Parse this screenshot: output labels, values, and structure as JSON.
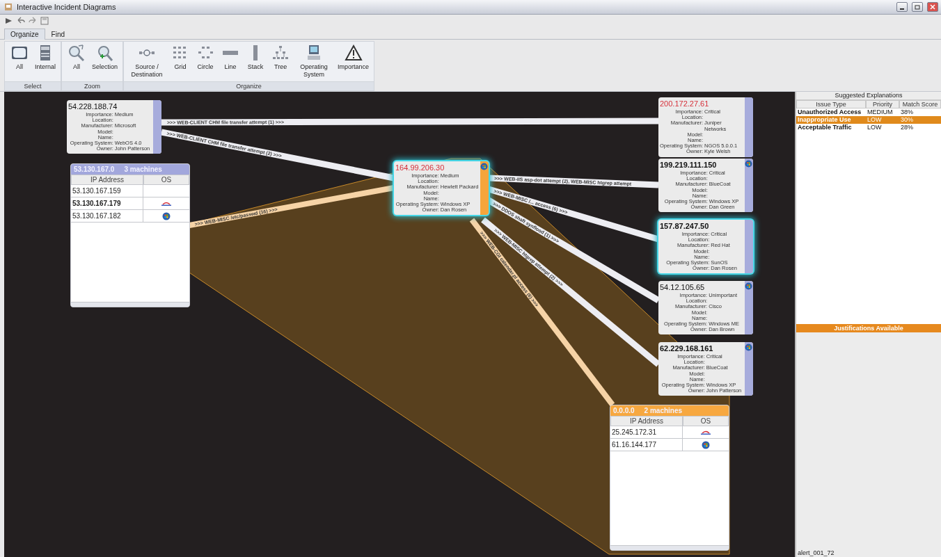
{
  "window": {
    "title": "Interactive Incident Diagrams"
  },
  "tabs": [
    {
      "label": "Organize",
      "selected": true
    },
    {
      "label": "Find",
      "selected": false
    }
  ],
  "ribbon": {
    "groups": [
      {
        "label": "Select",
        "buttons": [
          {
            "kind": "screen",
            "label": "All"
          },
          {
            "kind": "server",
            "label": "Internal"
          }
        ]
      },
      {
        "label": "Zoom",
        "buttons": [
          {
            "kind": "zoom-all",
            "label": "All"
          },
          {
            "kind": "zoom-selection",
            "label": "Selection"
          }
        ]
      },
      {
        "label": "Organize",
        "buttons": [
          {
            "kind": "source-destination",
            "label": "Source / Destination"
          },
          {
            "kind": "grid",
            "label": "Grid"
          },
          {
            "kind": "circle",
            "label": "Circle"
          },
          {
            "kind": "line",
            "label": "Line"
          },
          {
            "kind": "stack",
            "label": "Stack"
          },
          {
            "kind": "tree",
            "label": "Tree"
          },
          {
            "kind": "computer",
            "label": "Operating System"
          },
          {
            "kind": "warning",
            "label": "Importance"
          }
        ]
      }
    ]
  },
  "diagram": {
    "hull": true,
    "connections": [
      {
        "kind": "host-link",
        "label": ">>> WEB-CLIENT CHM file transfer attempt (1) >>>"
      },
      {
        "kind": "host-link",
        "label": ">>> WEB-CLIENT CHM file transfer attempt (2) >>>"
      },
      {
        "kind": "group-link",
        "label": ">>> WEB-MISC /etc/passwd (16) >>>"
      },
      {
        "kind": "host-link",
        "label": ">>> WEB-IIS asp-dot attempt (2), WEB-MISC htgrep attempt"
      },
      {
        "kind": "host-link",
        "label": ">>> WEB-MISC /... access (6) >>>"
      },
      {
        "kind": "host-link",
        "label": ">>> DDOS shaft synflood (1) >>>"
      },
      {
        "kind": "host-link",
        "label": ">>> WEB-MISC htgrep attempt (2) >>>"
      },
      {
        "kind": "group-link",
        "label": ">>> WEB-CGI calendar.pl access (6) >>>"
      }
    ],
    "hosts": [
      {
        "ip": "54.228.188.74",
        "alert": false,
        "highlighted": false,
        "kind": "host",
        "details": [
          {
            "label": "Importance:",
            "value": "Medium"
          },
          {
            "label": "Location:"
          },
          {
            "label": "Manufacturer:",
            "value": "Microsoft"
          },
          {
            "label": "Model:"
          },
          {
            "label": "Name:"
          },
          {
            "label": "Operating System:",
            "value": "WebOS 4.0"
          },
          {
            "label": "Owner:",
            "value": "John Patterson"
          }
        ]
      },
      {
        "ip": "200.172.27.61",
        "alert": true,
        "highlighted": false,
        "kind": "host",
        "details": [
          {
            "label": "Importance:",
            "value": "Critical"
          },
          {
            "label": "Location:"
          },
          {
            "label": "Manufacturer:",
            "value": "Juniper Networks"
          },
          {
            "label": "Model:"
          },
          {
            "label": "Name:"
          },
          {
            "label": "Operating System:",
            "value": "NGOS 5.0.0.1"
          },
          {
            "label": "Owner:",
            "value": "Kyle Welsh"
          }
        ]
      },
      {
        "ip": "164.99.206.30",
        "alert": true,
        "highlighted": true,
        "kind": "source",
        "details": [
          {
            "label": "Importance:",
            "value": "Medium"
          },
          {
            "label": "Location:"
          },
          {
            "label": "Manufacturer:",
            "value": "Hewlett Packard"
          },
          {
            "label": "Model:"
          },
          {
            "label": "Name:"
          },
          {
            "label": "Operating System:",
            "value": "Windows XP"
          },
          {
            "label": "Owner:",
            "value": "Dan Rosen"
          }
        ]
      },
      {
        "ip": "199.219.111.150",
        "alert": false,
        "highlighted": false,
        "kind": "host",
        "details": [
          {
            "label": "Importance:",
            "value": "Critical"
          },
          {
            "label": "Location:"
          },
          {
            "label": "Manufacturer:",
            "value": "BlueCoat"
          },
          {
            "label": "Model:"
          },
          {
            "label": "Name:"
          },
          {
            "label": "Operating System:",
            "value": "Windows XP"
          },
          {
            "label": "Owner:",
            "value": "Dan Green"
          }
        ]
      },
      {
        "ip": "157.87.247.50",
        "alert": false,
        "highlighted": true,
        "kind": "host",
        "details": [
          {
            "label": "Importance:",
            "value": "Critical"
          },
          {
            "label": "Location:"
          },
          {
            "label": "Manufacturer:",
            "value": "Red Hat"
          },
          {
            "label": "Model:"
          },
          {
            "label": "Name:"
          },
          {
            "label": "Operating System:",
            "value": "SunOS"
          },
          {
            "label": "Owner:",
            "value": "Dan Rosen"
          }
        ]
      },
      {
        "ip": "54.12.105.65",
        "alert": false,
        "highlighted": false,
        "kind": "host",
        "details": [
          {
            "label": "Importance:",
            "value": "Unimportant"
          },
          {
            "label": "Location:"
          },
          {
            "label": "Manufacturer:",
            "value": "Cisco"
          },
          {
            "label": "Model:"
          },
          {
            "label": "Name:"
          },
          {
            "label": "Operating System:",
            "value": "Windows ME"
          },
          {
            "label": "Owner:",
            "value": "Dan Brown"
          }
        ]
      },
      {
        "ip": "62.229.168.161",
        "alert": false,
        "highlighted": false,
        "kind": "host",
        "details": [
          {
            "label": "Importance:",
            "value": "Critical"
          },
          {
            "label": "Location:"
          },
          {
            "label": "Manufacturer:",
            "value": "BlueCoat"
          },
          {
            "label": "Model:"
          },
          {
            "label": "Name:"
          },
          {
            "label": "Operating System:",
            "value": "Windows XP"
          },
          {
            "label": "Owner:",
            "value": "John Patterson"
          }
        ]
      }
    ],
    "groups": [
      {
        "kind": "network",
        "network": "53.130.167.0",
        "count": "3 machines",
        "columns": [
          "IP Address",
          "OS"
        ],
        "rows": [
          {
            "ip": "53.130.167.159",
            "selected": false
          },
          {
            "ip": "53.130.167.179",
            "selected": true
          },
          {
            "ip": "53.130.167.182",
            "selected": false
          }
        ]
      },
      {
        "kind": "selected",
        "network": "0.0.0.0",
        "count": "2 machines",
        "columns": [
          "IP Address",
          "OS"
        ],
        "rows": [
          {
            "ip": "25.245.172.31",
            "selected": false
          },
          {
            "ip": "61.16.144.177",
            "selected": false
          }
        ]
      }
    ]
  },
  "explanations": {
    "title": "Suggested Explanations",
    "columns": [
      "Issue Type",
      "Priority",
      "Match Score"
    ],
    "rows": [
      {
        "issue": "Unauthorized Access",
        "priority": "MEDIUM",
        "score": "38%",
        "selected": false
      },
      {
        "issue": "Inappropriate Use",
        "priority": "LOW",
        "score": "30%",
        "selected": true
      },
      {
        "issue": "Acceptable Traffic",
        "priority": "LOW",
        "score": "28%",
        "selected": false
      }
    ]
  },
  "justifications": {
    "title": "Justifications Available"
  },
  "status_bar": {
    "text": "alert_001_72"
  }
}
